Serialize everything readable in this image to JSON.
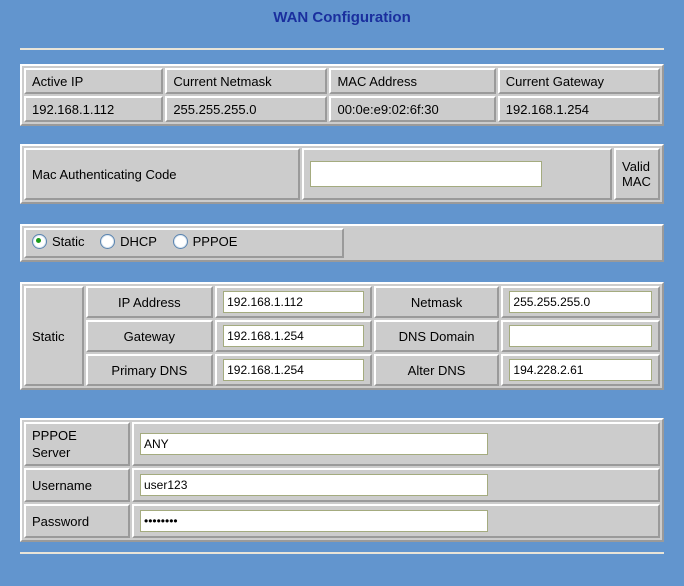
{
  "page": {
    "title": "WAN Configuration",
    "background_color": "#6295ce",
    "title_color": "#1a2f9e",
    "panel_color": "#cccccc",
    "input_border_color": "#a4ab7f"
  },
  "status_table": {
    "headers": [
      "Active IP",
      "Current Netmask",
      "MAC Address",
      "Current Gateway"
    ],
    "values": [
      "192.168.1.112",
      "255.255.255.0",
      "00:0e:e9:02:6f:30",
      "192.168.1.254"
    ]
  },
  "mac_auth": {
    "label": "Mac Authenticating Code",
    "input_value": "",
    "input_placeholder": "",
    "valid_line1": "Valid",
    "valid_line2": "MAC"
  },
  "mode": {
    "options": [
      {
        "label": "Static",
        "selected": true
      },
      {
        "label": "DHCP",
        "selected": false
      },
      {
        "label": "PPPOE",
        "selected": false
      }
    ]
  },
  "static_section": {
    "row_label": "Static",
    "rows": [
      {
        "label_left": "IP Address",
        "value_left": "192.168.1.112",
        "label_right": "Netmask",
        "value_right": "255.255.255.0"
      },
      {
        "label_left": "Gateway",
        "value_left": "192.168.1.254",
        "label_right": "DNS Domain",
        "value_right": ""
      },
      {
        "label_left": "Primary DNS",
        "value_left": "192.168.1.254",
        "label_right": "Alter DNS",
        "value_right": "194.228.2.61"
      }
    ]
  },
  "pppoe_section": {
    "rows": [
      {
        "label": "PPPOE\nServer",
        "label_line1": "PPPOE",
        "label_line2": "Server",
        "value": "ANY",
        "type": "text"
      },
      {
        "label": "Username",
        "value": "user123",
        "type": "text"
      },
      {
        "label": "Password",
        "value": "password",
        "masked_display": "••••••••",
        "type": "password"
      }
    ]
  }
}
